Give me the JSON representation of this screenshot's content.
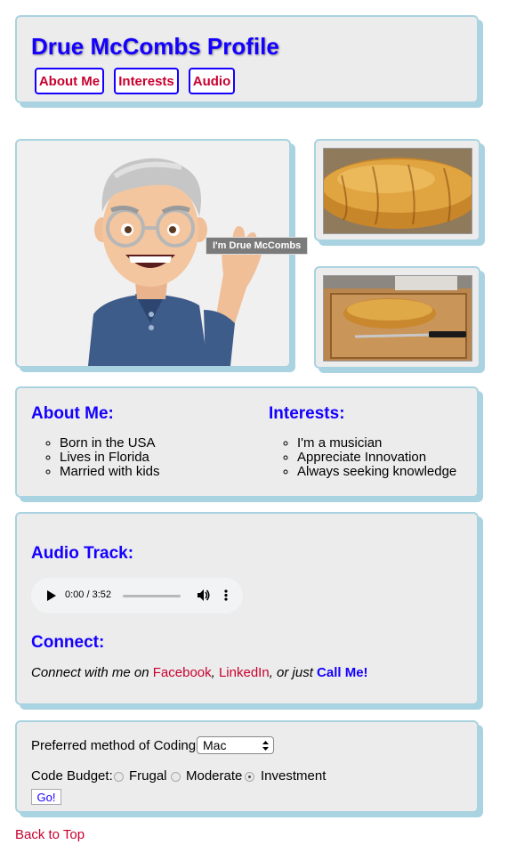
{
  "header": {
    "title": "Drue McCombs Profile",
    "nav": [
      "About Me",
      "Interests",
      "Audio"
    ]
  },
  "avatar": {
    "tooltip": "I'm Drue McCombs"
  },
  "about": {
    "heading": "About Me:",
    "items": [
      "Born in the USA",
      "Lives in Florida",
      "Married with kids"
    ]
  },
  "interests": {
    "heading": "Interests:",
    "items": [
      "I'm a musician",
      "Appreciate Innovation",
      "Always seeking knowledge"
    ]
  },
  "audio": {
    "heading": "Audio Track:",
    "time": "0:00 / 3:52",
    "progress": 0
  },
  "connect": {
    "heading": "Connect:",
    "prefix": "Connect with me on ",
    "facebook": "Facebook",
    "comma": ", ",
    "linkedin": "LinkedIn",
    "or_just": ", or just ",
    "call": "Call Me!"
  },
  "form": {
    "coding_label": "Preferred method of Coding:",
    "coding_value": "Mac",
    "budget_label": "Code Budget:",
    "options": [
      "Frugal",
      "Moderate",
      "Investment"
    ],
    "selected": "Investment",
    "submit": "Go!"
  },
  "back_to_top": "Back to Top"
}
